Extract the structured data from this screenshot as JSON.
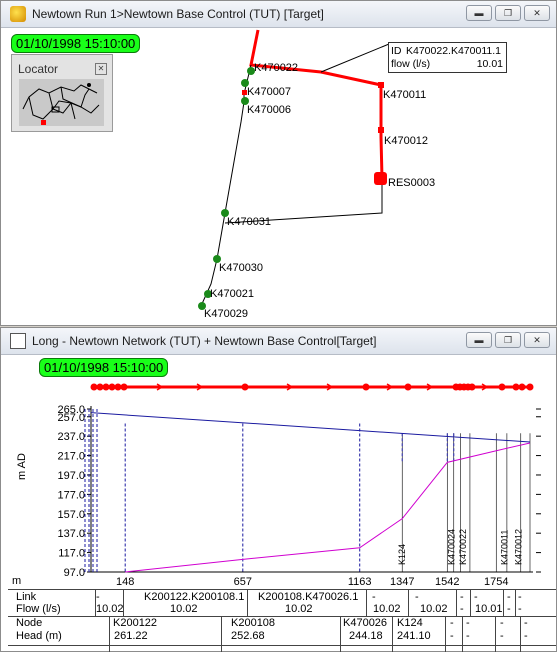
{
  "top_window": {
    "title": "Newtown Run 1>Newtown Base Control (TUT)  [Target]",
    "timestamp": "01/10/1998 15:10:00",
    "locator_title": "Locator",
    "tooltip": {
      "id_label": "ID",
      "id_value": "K470022.K470011.1",
      "flow_label": "flow (l/s)",
      "flow_value": "10.01"
    },
    "node_labels": [
      "K470022",
      "K470007",
      "K470006",
      "K470011",
      "K470012",
      "RES0003",
      "K470031",
      "K470030",
      "K470021",
      "K470029"
    ]
  },
  "bottom_window": {
    "title": "Long - Newtown Network (TUT) + Newtown Base Control[Target]",
    "timestamp": "01/10/1998 15:10:00",
    "y_axis_label": "m AD",
    "x_axis_unit": "m",
    "y_ticks": [
      "265.0",
      "257.0",
      "237.0",
      "217.0",
      "197.0",
      "177.0",
      "157.0",
      "137.0",
      "117.0",
      "97.0"
    ],
    "x_ticks": [
      "148",
      "657",
      "1163",
      "1347",
      "1542",
      "1754"
    ],
    "node_markers": [
      "K124",
      "K470024",
      "K470022",
      "K470011",
      "K470012"
    ],
    "table": {
      "row_labels": [
        "Link",
        "Flow (l/s)",
        "Node",
        "Head (m)"
      ],
      "link_values": [
        "-",
        "K200122.K200108.1",
        "K200108.K470026.1",
        "-",
        "-",
        "-",
        "-",
        "-",
        "-"
      ],
      "flow_values": [
        "10.02",
        "10.02",
        "10.02",
        "10.02",
        "10.02",
        "-",
        "10.01",
        "-",
        "-"
      ],
      "node_values": [
        "K200122",
        "K200108",
        "K470026",
        "K124",
        "-",
        "-",
        "-",
        "-"
      ],
      "head_values": [
        "261.22",
        "252.68",
        "244.18",
        "241.10",
        "-",
        "-",
        "-",
        "-"
      ]
    }
  },
  "chart_data": {
    "type": "line",
    "title": "",
    "xlabel": "m",
    "ylabel": "m AD",
    "ylim": [
      97,
      265
    ],
    "x_ticks": [
      148,
      657,
      1163,
      1347,
      1542,
      1754
    ],
    "series": [
      {
        "color": "#1a1aa0",
        "x": [
          0,
          1900
        ],
        "y": [
          261.22,
          231
        ]
      },
      {
        "color": "#d000d0",
        "x": [
          148,
          657,
          1163,
          1347,
          1542,
          1754,
          1900
        ],
        "y": [
          97,
          110,
          122,
          152,
          210,
          222,
          230
        ]
      }
    ]
  },
  "colors": {
    "pipe_red": "#ff0000",
    "node_green": "#1a8a1a",
    "stamp_green": "#19ff19",
    "hgl_blue": "#1a1aa0",
    "ground_magenta": "#d000d0"
  }
}
